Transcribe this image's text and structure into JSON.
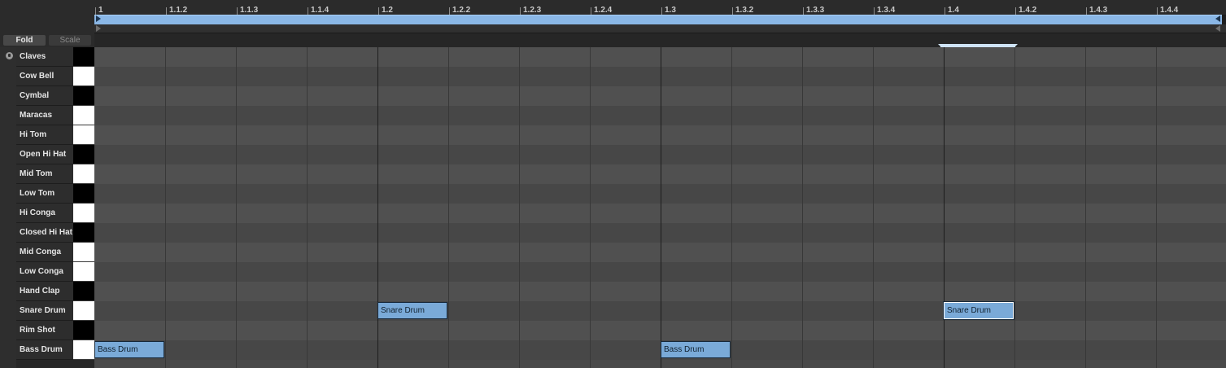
{
  "header": {
    "fold_label": "Fold",
    "scale_label": "Scale"
  },
  "ruler": {
    "labels": [
      "1",
      "1.1.2",
      "1.1.3",
      "1.1.4",
      "1.2",
      "1.2.2",
      "1.2.3",
      "1.2.4",
      "1.3",
      "1.3.2",
      "1.3.3",
      "1.3.4",
      "1.4",
      "1.4.2",
      "1.4.3",
      "1.4.4"
    ]
  },
  "drum_rows": [
    {
      "name": "Claves",
      "key": "black"
    },
    {
      "name": "Cow Bell",
      "key": "white"
    },
    {
      "name": "Cymbal",
      "key": "black"
    },
    {
      "name": "Maracas",
      "key": "white"
    },
    {
      "name": "Hi Tom",
      "key": "white"
    },
    {
      "name": "Open Hi Hat",
      "key": "black"
    },
    {
      "name": "Mid Tom",
      "key": "white"
    },
    {
      "name": "Low Tom",
      "key": "black"
    },
    {
      "name": "Hi Conga",
      "key": "white"
    },
    {
      "name": "Closed Hi Hat",
      "key": "black"
    },
    {
      "name": "Mid Conga",
      "key": "white"
    },
    {
      "name": "Low Conga",
      "key": "white"
    },
    {
      "name": "Hand Clap",
      "key": "black"
    },
    {
      "name": "Snare Drum",
      "key": "white"
    },
    {
      "name": "Rim Shot",
      "key": "black"
    },
    {
      "name": "Bass Drum",
      "key": "white"
    }
  ],
  "notes": [
    {
      "label": "Snare Drum",
      "row": 13,
      "start_step": 4,
      "length_steps": 1,
      "selected": false
    },
    {
      "label": "Snare Drum",
      "row": 13,
      "start_step": 12,
      "length_steps": 1,
      "selected": true
    },
    {
      "label": "Bass Drum",
      "row": 15,
      "start_step": 0,
      "length_steps": 1,
      "selected": false
    },
    {
      "label": "Bass Drum",
      "row": 15,
      "start_step": 8,
      "length_steps": 1,
      "selected": false
    }
  ],
  "colors": {
    "note_fill": "#7aaad8",
    "loop_bar": "#8ab7e6",
    "selected_note_border": "#ffffff"
  },
  "icons": {
    "fold_toggle": "fold-circle-icon",
    "loop_start": "loop-start-marker-icon",
    "loop_end": "loop-end-marker-icon"
  }
}
